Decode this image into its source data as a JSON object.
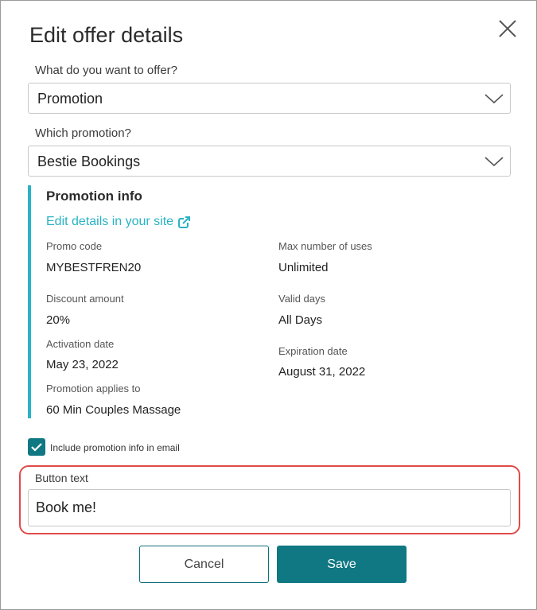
{
  "dialog": {
    "title": "Edit offer details"
  },
  "offer_type": {
    "label": "What do you want to offer?",
    "selected": "Promotion"
  },
  "promotion_select": {
    "label": "Which promotion?",
    "selected": "Bestie Bookings"
  },
  "promo_info": {
    "title": "Promotion info",
    "edit_link": "Edit details in your site",
    "promo_code_label": "Promo code",
    "promo_code": "MYBESTFREN20",
    "max_uses_label": "Max number of uses",
    "max_uses": "Unlimited",
    "discount_label": "Discount amount",
    "discount": "20%",
    "valid_days_label": "Valid days",
    "valid_days": "All Days",
    "activation_label": "Activation date",
    "activation": "May 23, 2022",
    "expiration_label": "Expiration date",
    "expiration": "August 31, 2022",
    "applies_label": "Promotion applies to",
    "applies": "60 Min Couples Massage"
  },
  "include_promo": {
    "label": "Include promotion info in email",
    "checked": true
  },
  "button_text": {
    "label": "Button text",
    "value": "Book me!"
  },
  "actions": {
    "cancel": "Cancel",
    "save": "Save"
  },
  "colors": {
    "accent": "#2ab3c5",
    "primary": "#107883",
    "highlight": "#e04a4a"
  }
}
